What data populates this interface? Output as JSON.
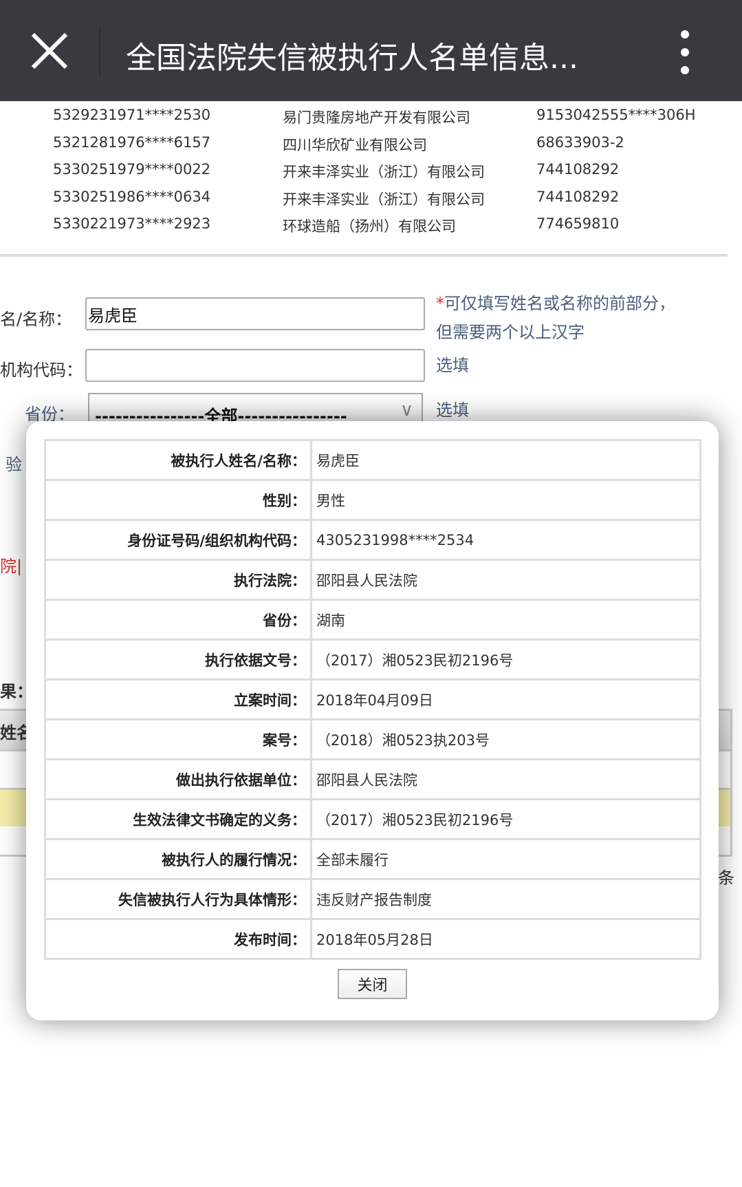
{
  "header": {
    "title": "全国法院失信被执行人名单信息...",
    "close_icon": "close-icon",
    "menu_icon": "more-vertical-icon"
  },
  "top_list": [
    [
      "5329231971****2530",
      "易门贵隆房地产开发有限公司",
      "9153042555****306H"
    ],
    [
      "5321281976****6157",
      "四川华欣矿业有限公司",
      "68633903-2"
    ],
    [
      "5330251979****0022",
      "开来丰泽实业（浙江）有限公司",
      "744108292"
    ],
    [
      "5330251986****0634",
      "开来丰泽实业（浙江）有限公司",
      "744108292"
    ],
    [
      "5330221973****2923",
      "环球造船（扬州）有限公司",
      "774659810"
    ]
  ],
  "form": {
    "name_label": "名/名称：",
    "name_value": "易虎臣",
    "name_hint_star": "*",
    "name_hint": "可仅填写姓名或名称的前部分，",
    "name_hint2": "但需要两个以上汉字",
    "code_label": "机构代码：",
    "code_value": "",
    "code_hint": "选填",
    "province_label": "省份：",
    "province_value": "----------------全部----------------",
    "province_hint": "选填"
  },
  "background": {
    "verify": "验",
    "court": "院|",
    "result": "果：",
    "col_name": "姓名",
    "count_suffix": "条"
  },
  "modal": {
    "rows": [
      {
        "label": "被执行人姓名/名称：",
        "value": "易虎臣"
      },
      {
        "label": "性别：",
        "value": "男性"
      },
      {
        "label": "身份证号码/组织机构代码：",
        "value": "4305231998****2534"
      },
      {
        "label": "执行法院：",
        "value": "邵阳县人民法院"
      },
      {
        "label": "省份：",
        "value": "湖南"
      },
      {
        "label": "执行依据文号：",
        "value": "（2017）湘0523民初2196号"
      },
      {
        "label": "立案时间：",
        "value": "2018年04月09日"
      },
      {
        "label": "案号：",
        "value": "（2018）湘0523执203号"
      },
      {
        "label": "做出执行依据单位：",
        "value": "邵阳县人民法院"
      },
      {
        "label": "生效法律文书确定的义务：",
        "value": "（2017）湘0523民初2196号"
      },
      {
        "label": "被执行人的履行情况：",
        "value": "全部未履行"
      },
      {
        "label": "失信被执行人行为具体情形：",
        "value": "违反财产报告制度"
      },
      {
        "label": "发布时间：",
        "value": "2018年05月28日"
      }
    ],
    "close_label": "关闭"
  }
}
